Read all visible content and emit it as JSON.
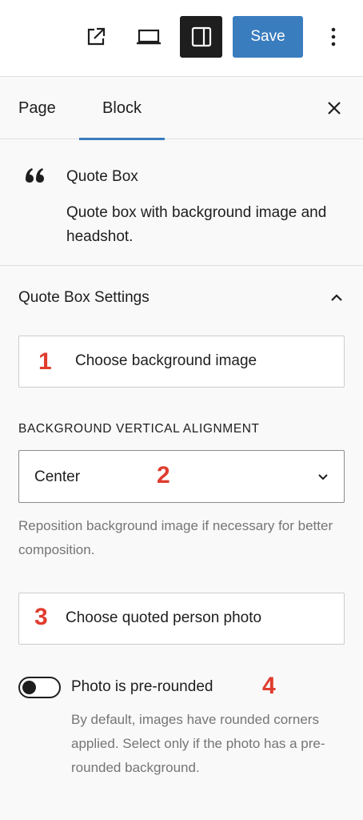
{
  "toolbar": {
    "external_icon": "external-link-icon",
    "preview_icon": "laptop-icon",
    "sidebar_icon": "sidebar-panel-icon",
    "save_label": "Save",
    "more_icon": "more-vertical-icon",
    "save_color": "#3a7dbf"
  },
  "tabs": {
    "page_label": "Page",
    "block_label": "Block",
    "active": "Block",
    "close_icon": "close-icon"
  },
  "block": {
    "icon": "quote-icon",
    "title": "Quote Box",
    "description": "Quote box with background image and headshot."
  },
  "panel": {
    "title": "Quote Box Settings",
    "expanded": true,
    "background_button_label": "Choose background image",
    "alignment_label": "Background vertical alignment",
    "alignment_value": "Center",
    "alignment_help": "Reposition background image if necessary for better composition.",
    "photo_button_label": "Choose quoted person photo",
    "prerounded_label": "Photo is pre-rounded",
    "prerounded_checked": false,
    "prerounded_help": "By default, images have rounded corners applied. Select only if the photo has a pre-rounded background."
  },
  "markers": {
    "m1": "1",
    "m2": "2",
    "m3": "3",
    "m4": "4",
    "color": "#e03c2e"
  }
}
